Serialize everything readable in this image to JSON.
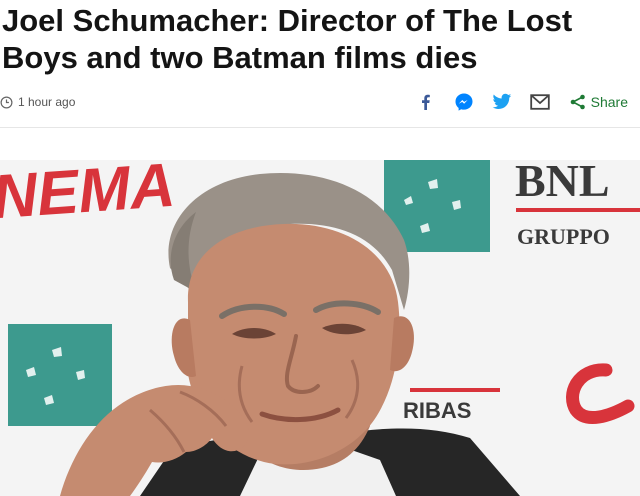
{
  "article": {
    "headline": "Joel Schumacher: Director of The Lost Boys and two Batman films dies",
    "timestamp": "1 hour ago"
  },
  "share": {
    "label": "Share",
    "icons": [
      "facebook-icon",
      "messenger-icon",
      "twitter-icon",
      "email-icon",
      "share-icon"
    ]
  },
  "photo": {
    "backdrop_texts": [
      "NEMA",
      "BNL",
      "GRUPPO",
      "RIBAS"
    ]
  },
  "colors": {
    "facebook": "#3b5998",
    "messenger": "#0084ff",
    "twitter": "#1da1f2",
    "share": "#1f7a35"
  }
}
